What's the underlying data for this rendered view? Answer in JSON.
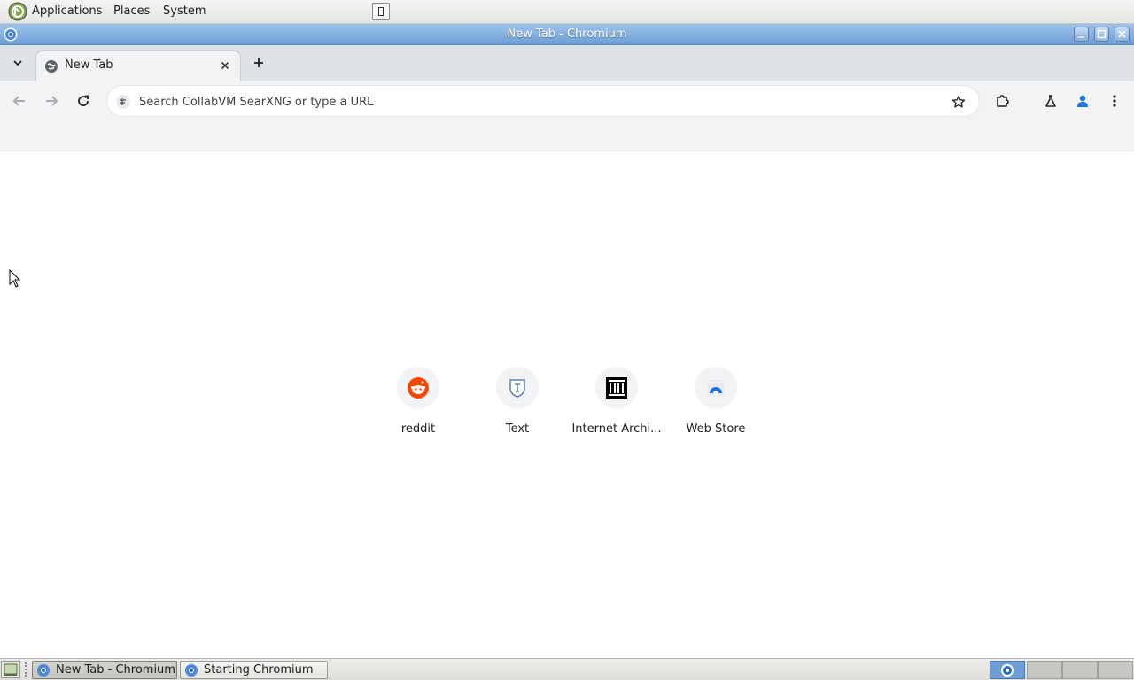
{
  "top_panel": {
    "menus": [
      "Applications",
      "Places",
      "System"
    ]
  },
  "window": {
    "title": "New Tab - Chromium"
  },
  "tabs": [
    {
      "title": "New Tab",
      "active": true
    }
  ],
  "toolbar": {
    "omnibox_placeholder": "Search CollabVM SearXNG or type a URL"
  },
  "shortcuts": [
    {
      "label": "reddit",
      "icon": "reddit-icon",
      "color": "#ff4500"
    },
    {
      "label": "Text",
      "icon": "text-shield-icon",
      "color": "#5f7fa6"
    },
    {
      "label": "Internet Archi...",
      "icon": "internet-archive-icon",
      "color": "#000000"
    },
    {
      "label": "Web Store",
      "icon": "web-store-icon",
      "color": "#1a73e8"
    }
  ],
  "taskbar": {
    "tasks": [
      {
        "label": "New Tab - Chromium",
        "active": true
      },
      {
        "label": "Starting Chromium",
        "active": false
      }
    ]
  },
  "colors": {
    "titlebar": "#6d9fd6",
    "tabstrip": "#dfe3e8",
    "toolbar": "#f1f3f4",
    "accent": "#1a73e8"
  }
}
